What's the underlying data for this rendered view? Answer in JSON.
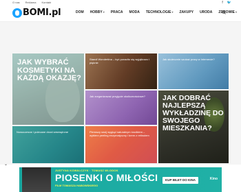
{
  "topbar": {
    "links": [
      "O nas",
      "Reklama",
      "Kontakt"
    ],
    "social_icons": [
      "facebook-icon",
      "twitter-icon"
    ]
  },
  "brand": {
    "logo_text": "BOMI.pl"
  },
  "nav": {
    "items": [
      {
        "label": "DOM",
        "has_dropdown": false
      },
      {
        "label": "HOBBY",
        "has_dropdown": true
      },
      {
        "label": "PRACA",
        "has_dropdown": false
      },
      {
        "label": "MODA",
        "has_dropdown": false
      },
      {
        "label": "TECHNOLOGIE",
        "has_dropdown": true
      },
      {
        "label": "ZAKUPY",
        "has_dropdown": false
      },
      {
        "label": "URODA",
        "has_dropdown": false
      },
      {
        "label": "ZDROWIE",
        "has_dropdown": true
      }
    ],
    "search_icon": "search-icon"
  },
  "tiles": [
    {
      "id": "t1",
      "title": "JAK WYBRAĆ KOSMETYKI NA KAŻDĄ OKAZJĘ?"
    },
    {
      "id": "t2",
      "caption": "Standi Wondertina – być ponadto się wyjątkowo i pięknie"
    },
    {
      "id": "t3",
      "caption": "Jak zorganizować przyjęcie okolicznościowe?"
    },
    {
      "id": "t4",
      "caption": "Jak skutecznie szukać pracy w Internecie?"
    },
    {
      "id": "t5",
      "title": "JAK DOBRAĆ NAJLEPSZĄ WYKŁADZINĘ DO SWOJEGO MIESZKANIA?"
    },
    {
      "id": "t6",
      "caption": "Nowoczesne i polecane drzwi wewnętrzne"
    },
    {
      "id": "t7",
      "caption": "Pierwszy swój wygląd naturalnym środkiem – wybierz peeling enzymatyczny i krem z retinolem"
    }
  ],
  "ad": {
    "top_line": "JUSTYNA KOWALCZYK · TOMASZ WLODOK",
    "title": "PIOSENKI O MIŁOŚCI",
    "sub_line": "FILM TOMASZA HABOWSKIEGO",
    "cta": "KUP BILET DO KINA",
    "brand": "Kino"
  },
  "colors": {
    "accent": "#1aa3ff",
    "ad_bg": "#1aa8a0",
    "ad_text": "#f5f54e"
  }
}
